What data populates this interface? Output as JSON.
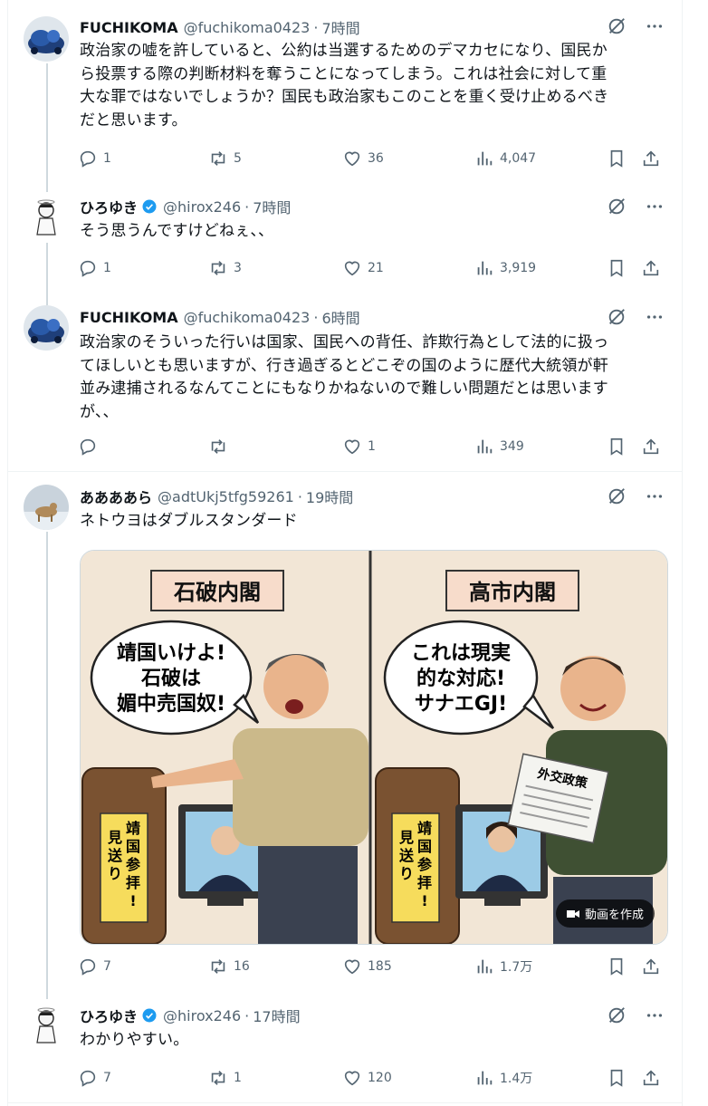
{
  "tweets": [
    {
      "name": "FUCHIKOMA",
      "handle": "@fuchikoma0423",
      "time": "7時間",
      "verified": false,
      "text_lines": [
        "政治家の嘘を許していると、公約は当選するためのデマカセになり、国民か",
        "ら投票する際の判断材料を奪うことになってしまう。これは社会に対して重",
        "大な罪ではないでしょうか？国民も政治家もこのことを重く受け止めるべき",
        "だと思います。"
      ],
      "replies": "1",
      "reposts": "5",
      "likes": "36",
      "views": "4,047"
    },
    {
      "name": "ひろゆき",
      "handle": "@hirox246",
      "time": "7時間",
      "verified": true,
      "text_lines": [
        "そう思うんですけどねぇ、、"
      ],
      "replies": "1",
      "reposts": "3",
      "likes": "21",
      "views": "3,919"
    },
    {
      "name": "FUCHIKOMA",
      "handle": "@fuchikoma0423",
      "time": "6時間",
      "verified": false,
      "text_lines": [
        "政治家のそういった行いは国家、国民への背任、詐欺行為として法的に扱っ",
        "てほしいとも思いますが、行き過ぎるとどこぞの国のように歴代大統領が軒",
        "並み逮捕されるなんてことにもなりかねないので難しい問題だとは思います",
        "が、、"
      ],
      "replies": "",
      "reposts": "",
      "likes": "1",
      "views": "349"
    },
    {
      "name": "ああああら",
      "handle": "@adtUkj5tfg59261",
      "time": "19時間",
      "verified": false,
      "text_lines": [
        "ネトウヨはダブルスタンダード"
      ],
      "replies": "7",
      "reposts": "16",
      "likes": "185",
      "views": "1.7万",
      "image": {
        "left_title": "石破内閣",
        "left_bubble": [
          "靖国いけよ!",
          "石破は",
          "媚中売国奴!"
        ],
        "left_sign": [
          "靖",
          "国",
          "参",
          "拝",
          "!"
        ],
        "left_sign2": [
          "見",
          "送",
          "り"
        ],
        "right_title": "高市内閣",
        "right_bubble": [
          "これは現実",
          "的な対応!",
          "サナエGJ!"
        ],
        "newspaper_title": "外交政策",
        "make_video": "動画を作成"
      }
    },
    {
      "name": "ひろゆき",
      "handle": "@hirox246",
      "time": "17時間",
      "verified": true,
      "text_lines": [
        "わかりやすい。"
      ],
      "replies": "7",
      "reposts": "1",
      "likes": "120",
      "views": "1.4万"
    }
  ],
  "colors": {
    "secondary": "#536471",
    "verified": "#1d9bf0",
    "border": "#eff3f4"
  },
  "icons": [
    "reply-icon",
    "repost-icon",
    "like-icon",
    "views-icon",
    "bookmark-icon",
    "share-icon",
    "grok-icon",
    "more-icon",
    "verified-icon"
  ]
}
